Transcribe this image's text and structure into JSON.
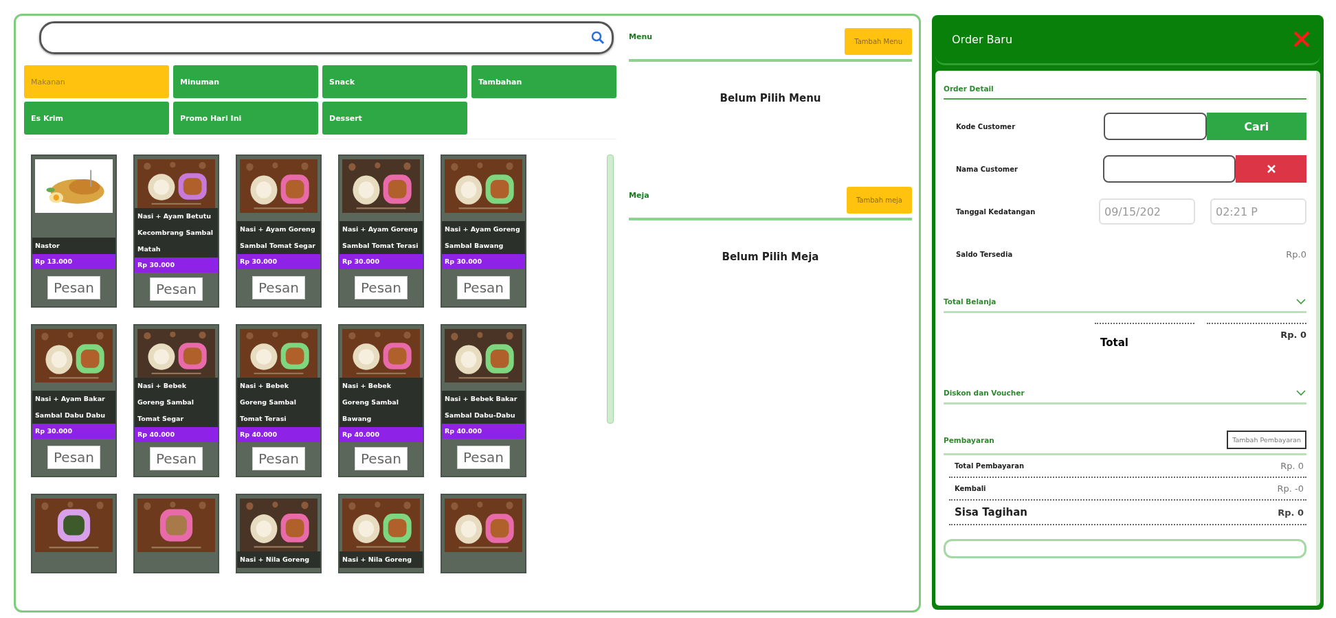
{
  "categories": [
    {
      "label": "Makanan",
      "selected": true
    },
    {
      "label": "Minuman",
      "selected": false
    },
    {
      "label": "Snack",
      "selected": false
    },
    {
      "label": "Tambahan",
      "selected": false
    },
    {
      "label": "Es Krim",
      "selected": false
    },
    {
      "label": "Promo Hari Ini",
      "selected": false
    },
    {
      "label": "Dessert",
      "selected": false
    }
  ],
  "menu_cards": [
    {
      "kind": "full",
      "name": "Nastor",
      "price": "Rp 13.000",
      "button": "Pesan"
    },
    {
      "kind": "full",
      "name": "Nasi + Ayam Betutu Kecombrang Sambal Matah",
      "price": "Rp 30.000",
      "button": "Pesan"
    },
    {
      "kind": "full",
      "name": "Nasi + Ayam Goreng Sambal Tomat Segar",
      "price": "Rp 30.000",
      "button": "Pesan"
    },
    {
      "kind": "full",
      "name": "Nasi + Ayam Goreng Sambal Tomat Terasi",
      "price": "Rp 30.000",
      "button": "Pesan"
    },
    {
      "kind": "full",
      "name": "Nasi + Ayam Goreng Sambal Bawang",
      "price": "Rp 30.000",
      "button": "Pesan"
    },
    {
      "kind": "full",
      "name": "Nasi + Ayam Bakar Sambal Dabu Dabu",
      "price": "Rp 30.000",
      "button": "Pesan"
    },
    {
      "kind": "full",
      "name": "Nasi + Bebek Goreng Sambal Tomat Segar",
      "price": "Rp 40.000",
      "button": "Pesan"
    },
    {
      "kind": "full",
      "name": "Nasi + Bebek Goreng Sambal Tomat Terasi",
      "price": "Rp 40.000",
      "button": "Pesan"
    },
    {
      "kind": "full",
      "name": "Nasi + Bebek Goreng Sambal Bawang",
      "price": "Rp 40.000",
      "button": "Pesan"
    },
    {
      "kind": "full",
      "name": "Nasi + Bebek Bakar Sambal Dabu-Dabu",
      "price": "Rp 40.000",
      "button": "Pesan"
    },
    {
      "kind": "cut"
    },
    {
      "kind": "cut"
    },
    {
      "kind": "cut",
      "name": "Nasi + Nila Goreng"
    },
    {
      "kind": "cut",
      "name": "Nasi + Nila Goreng"
    },
    {
      "kind": "cut"
    }
  ],
  "menu_section": {
    "title": "Menu",
    "button": "Tambah Menu",
    "empty_text": "Belum Pilih Menu"
  },
  "table_section": {
    "title": "Meja",
    "button": "Tambah meja",
    "empty_text": "Belum Pilih Meja"
  },
  "order_panel": {
    "title": "Order Baru",
    "section": "Order Detail",
    "customer_code": {
      "label": "Kode Customer",
      "button": "Cari"
    },
    "customer_name": {
      "label": "Nama Customer"
    },
    "arrival": {
      "label": "Tanggal Kedatangan",
      "date": "09/15/202",
      "time": "02:21 P"
    },
    "balance": {
      "label": "Saldo Tersedia",
      "value": "Rp.0"
    },
    "total_shopping": {
      "title": "Total Belanja",
      "total_label": "Total",
      "total_value": "Rp. 0"
    },
    "discount": {
      "title": "Diskon dan Voucher"
    },
    "payment": {
      "title": "Pembayaran",
      "button": "Tambah Pembayaran",
      "rows": [
        {
          "label": "Total Pembayaran",
          "value": "Rp. 0",
          "kind": "normal"
        },
        {
          "label": "Kembali",
          "value": "Rp. -0",
          "kind": "normal"
        },
        {
          "label": "Sisa Tagihan",
          "value": "Rp. 0",
          "kind": "large"
        }
      ]
    }
  }
}
